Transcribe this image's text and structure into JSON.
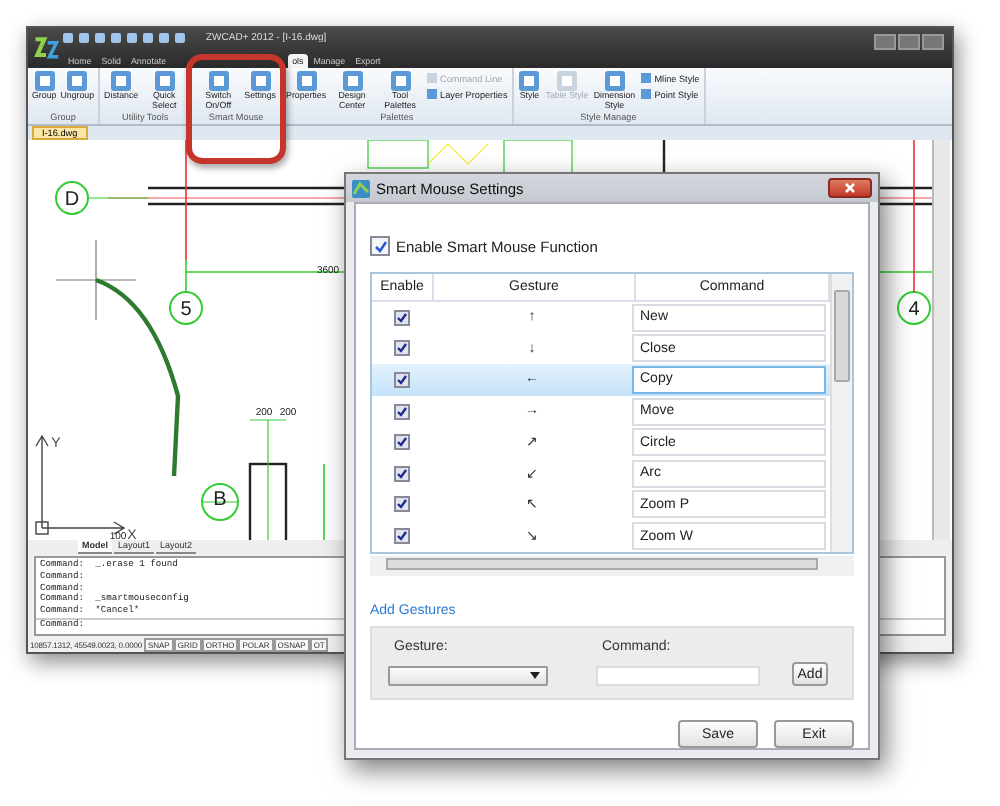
{
  "window": {
    "title": "ZWCAD+ 2012 - [I-16.dwg]"
  },
  "ribbon_tabs": [
    {
      "label": "Home",
      "selected": false
    },
    {
      "label": "Solid",
      "selected": false
    },
    {
      "label": "Annotate",
      "selected": false
    },
    {
      "label": "ols",
      "selected": true
    },
    {
      "label": "Manage",
      "selected": false
    },
    {
      "label": "Export",
      "selected": false
    }
  ],
  "ribbon_groups": [
    {
      "label": "Group",
      "highlighted": false,
      "tools": [
        {
          "label": "Group",
          "kind": "large",
          "disabled": false
        },
        {
          "label": "Ungroup",
          "kind": "large",
          "disabled": false
        }
      ]
    },
    {
      "label": "Utility Tools",
      "highlighted": false,
      "tools": [
        {
          "label": "Distance",
          "kind": "large",
          "disabled": false
        },
        {
          "label": "Quick Select",
          "kind": "large",
          "disabled": false
        }
      ]
    },
    {
      "label": "Smart Mouse",
      "highlighted": true,
      "tools": [
        {
          "label": "Switch On/Off",
          "kind": "large",
          "disabled": false
        },
        {
          "label": "Settings",
          "kind": "large",
          "disabled": false
        }
      ]
    },
    {
      "label": "Palettes",
      "highlighted": false,
      "tools": [
        {
          "label": "Properties",
          "kind": "large",
          "disabled": false
        },
        {
          "label": "Design Center",
          "kind": "large",
          "disabled": false
        },
        {
          "label": "Tool Palettes",
          "kind": "large",
          "disabled": false
        },
        {
          "label": "Command Line",
          "kind": "small",
          "disabled": true
        },
        {
          "label": "Layer Properties",
          "kind": "small",
          "disabled": false
        }
      ]
    },
    {
      "label": "Style Manage",
      "highlighted": false,
      "tools": [
        {
          "label": "Style",
          "kind": "large",
          "disabled": false
        },
        {
          "label": "Table Style",
          "kind": "large",
          "disabled": true
        },
        {
          "label": "Dimension Style",
          "kind": "large",
          "disabled": false
        },
        {
          "label": "Mline Style",
          "kind": "small",
          "disabled": false
        },
        {
          "label": "Point Style",
          "kind": "small",
          "disabled": false
        }
      ]
    }
  ],
  "document_tab": "I-16.dwg",
  "drawing_labels": [
    {
      "text": "D",
      "kind": "bubble"
    },
    {
      "text": "5",
      "kind": "bubble"
    },
    {
      "text": "4",
      "kind": "bubble"
    },
    {
      "text": "B",
      "kind": "bubble"
    },
    {
      "text": "3600",
      "kind": "dimension"
    },
    {
      "text": "200",
      "kind": "dimension"
    },
    {
      "text": "200",
      "kind": "dimension"
    },
    {
      "text": "100",
      "kind": "dimension"
    },
    {
      "text": "Y",
      "kind": "axis"
    },
    {
      "text": "X",
      "kind": "axis"
    }
  ],
  "layout_tabs": [
    {
      "label": "Model",
      "selected": true
    },
    {
      "label": "Layout1",
      "selected": false
    },
    {
      "label": "Layout2",
      "selected": false
    }
  ],
  "command_history": [
    "Command:  _.erase 1 found",
    "Command:",
    "Command:",
    "Command:  _smartmouseconfig",
    "Command:  *Cancel*"
  ],
  "command_prompt": "Command:",
  "coordinates": "10857.1312, 45549.0023, 0.0000",
  "status_toggles": [
    "SNAP",
    "GRID",
    "ORTHO",
    "POLAR",
    "OSNAP",
    "OT"
  ],
  "dialog": {
    "title": "Smart Mouse Settings",
    "enable": {
      "label": "Enable Smart Mouse Function",
      "checked": true
    },
    "columns": [
      "Enable",
      "Gesture",
      "Command"
    ],
    "rows": [
      {
        "enabled": true,
        "gesture": "↑",
        "command": "New",
        "selected": false
      },
      {
        "enabled": true,
        "gesture": "↓",
        "command": "Close",
        "selected": false
      },
      {
        "enabled": true,
        "gesture": "←",
        "command": "Copy",
        "selected": true
      },
      {
        "enabled": true,
        "gesture": "→",
        "command": "Move",
        "selected": false
      },
      {
        "enabled": true,
        "gesture": "↗",
        "command": "Circle",
        "selected": false
      },
      {
        "enabled": true,
        "gesture": "↙",
        "command": "Arc",
        "selected": false
      },
      {
        "enabled": true,
        "gesture": "↖",
        "command": "Zoom P",
        "selected": false
      },
      {
        "enabled": true,
        "gesture": "↘",
        "command": "Zoom W",
        "selected": false
      }
    ],
    "add_link": "Add Gestures",
    "gesture_label": "Gesture:",
    "command_label": "Command:",
    "add_button": "Add",
    "buttons": [
      "Save",
      "Exit"
    ]
  }
}
